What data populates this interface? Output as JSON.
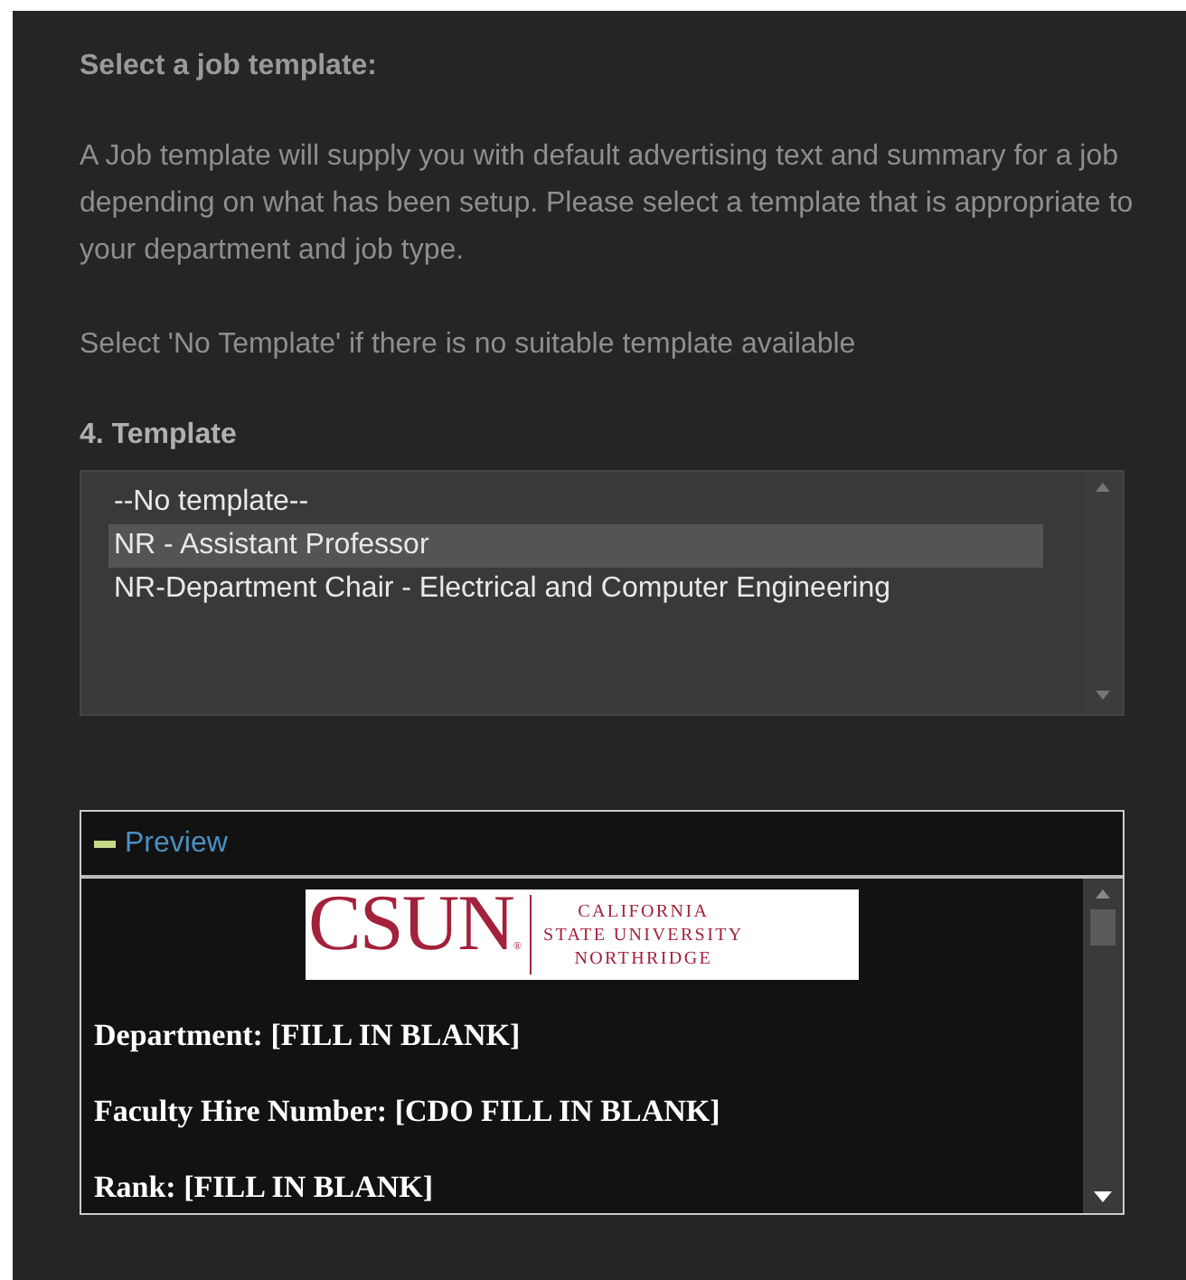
{
  "heading": "Select a job template:",
  "paragraphs": [
    "A Job template will supply you with default advertising text and summary for a job depending on what has been setup. Please select a template that is appropriate to your department and job type.",
    "Select 'No Template' if there is no suitable template available"
  ],
  "template_field": {
    "label": "4. Template",
    "options": [
      {
        "label": "--No template--",
        "selected": false
      },
      {
        "label": "NR - Assistant Professor",
        "selected": true
      },
      {
        "label": "NR-Department Chair - Electrical and Computer Engineering",
        "selected": false
      }
    ]
  },
  "preview": {
    "title": "Preview",
    "expanded": true,
    "logo": {
      "wordmark": "CSUN",
      "mark": "®",
      "lines": [
        "CALIFORNIA",
        "STATE UNIVERSITY",
        "NORTHRIDGE"
      ]
    },
    "fields": [
      "Department:  [FILL IN BLANK]",
      "Faculty Hire Number: [CDO FILL IN BLANK]",
      "Rank: [FILL IN BLANK]"
    ]
  }
}
